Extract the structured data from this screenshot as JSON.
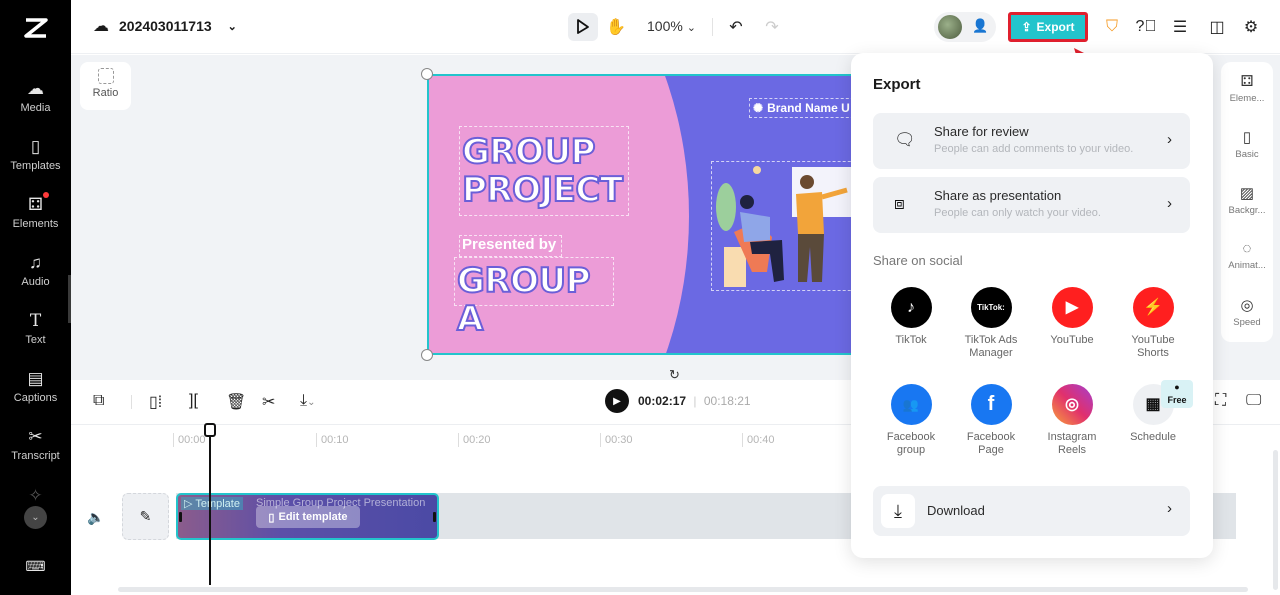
{
  "header": {
    "project_name": "202403011713",
    "zoom_level": "100%",
    "export_label": "Export"
  },
  "sidebar": {
    "items": [
      {
        "label": "Media",
        "icon": "cloud-upload-icon"
      },
      {
        "label": "Templates",
        "icon": "template-icon"
      },
      {
        "label": "Elements",
        "icon": "elements-icon",
        "badge": true
      },
      {
        "label": "Audio",
        "icon": "music-note-icon"
      },
      {
        "label": "Text",
        "icon": "text-icon"
      },
      {
        "label": "Captions",
        "icon": "captions-icon"
      },
      {
        "label": "Transcript",
        "icon": "transcript-icon"
      }
    ]
  },
  "canvas": {
    "ratio_label": "Ratio",
    "slide": {
      "title_line1": "GROUP",
      "title_line2": "PROJECT",
      "presented_by": "Presented by",
      "group": "GROUP A",
      "brand": "Brand Name U"
    }
  },
  "right_panel": {
    "items": [
      {
        "label": "Eleme...",
        "icon": "elements-icon"
      },
      {
        "label": "Basic",
        "icon": "basic-icon"
      },
      {
        "label": "Backgr...",
        "icon": "background-icon"
      },
      {
        "label": "Animat...",
        "icon": "animation-icon"
      },
      {
        "label": "Speed",
        "icon": "speed-icon"
      }
    ]
  },
  "playback": {
    "current_time": "00:02:17",
    "separator": "|",
    "total_time": "00:18:21"
  },
  "timeline": {
    "ticks": [
      "00:00",
      "00:10",
      "00:20",
      "00:30",
      "00:40"
    ],
    "clip": {
      "tag": "Template",
      "title": "Simple Group Project Presentation",
      "edit_label": "Edit template"
    }
  },
  "export_panel": {
    "title": "Export",
    "options": [
      {
        "title": "Share for review",
        "subtitle": "People can add comments to your video."
      },
      {
        "title": "Share as presentation",
        "subtitle": "People can only watch your video."
      }
    ],
    "social_label": "Share on social",
    "social": [
      {
        "label1": "TikTok",
        "label2": "",
        "color": "#000000"
      },
      {
        "label1": "TikTok Ads",
        "label2": "Manager",
        "color": "#000000"
      },
      {
        "label1": "YouTube",
        "label2": "",
        "color": "#ff1f1f"
      },
      {
        "label1": "YouTube",
        "label2": "Shorts",
        "color": "#ff1f1f"
      },
      {
        "label1": "Facebook",
        "label2": "group",
        "color": "#1877f2"
      },
      {
        "label1": "Facebook",
        "label2": "Page",
        "color": "#1877f2"
      },
      {
        "label1": "Instagram",
        "label2": "Reels",
        "color": "#e1306c"
      },
      {
        "label1": "Schedule",
        "label2": "",
        "color": "#eef0f3",
        "badge": "Free"
      }
    ],
    "download_label": "Download"
  },
  "colors": {
    "accent": "#23c4cc",
    "highlight_border": "#e0202e",
    "slide_pink": "#ec9cd7",
    "slide_purple": "#6b69e3"
  }
}
